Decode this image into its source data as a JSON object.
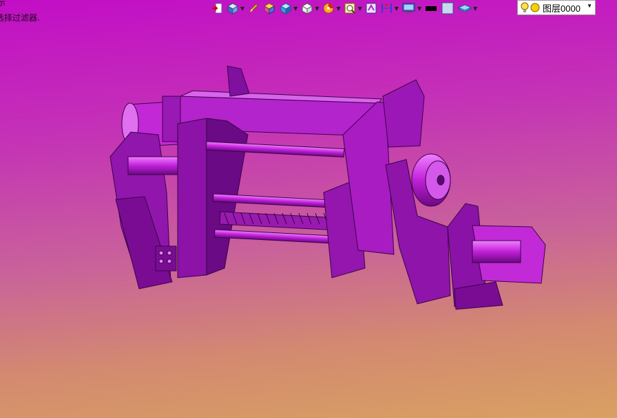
{
  "prompt": {
    "line1": "示",
    "line2": "选择过滤器."
  },
  "toolbar": {
    "icons": [
      "exit-sketch-icon",
      "view-orient-icon",
      "pencil-icon",
      "shaded-box-icon",
      "cube-view-icon",
      "wireframe-box-icon",
      "section-pie-icon",
      "zoom-icon",
      "display-style-icon",
      "dimension-icon",
      "monitor-icon",
      "color-swatch-icon",
      "background-icon",
      "layer-stack-icon"
    ],
    "foreground_color": "#000000",
    "background_swatch_color": "#c8d8f0"
  },
  "layer": {
    "name": "图层0000",
    "lightbulb_color": "#ffe14a",
    "sun_color": "#f2d200"
  },
  "model": {
    "color": "#b41ed0",
    "dark_color": "#6c0a84",
    "light_color": "#dd60ee"
  }
}
